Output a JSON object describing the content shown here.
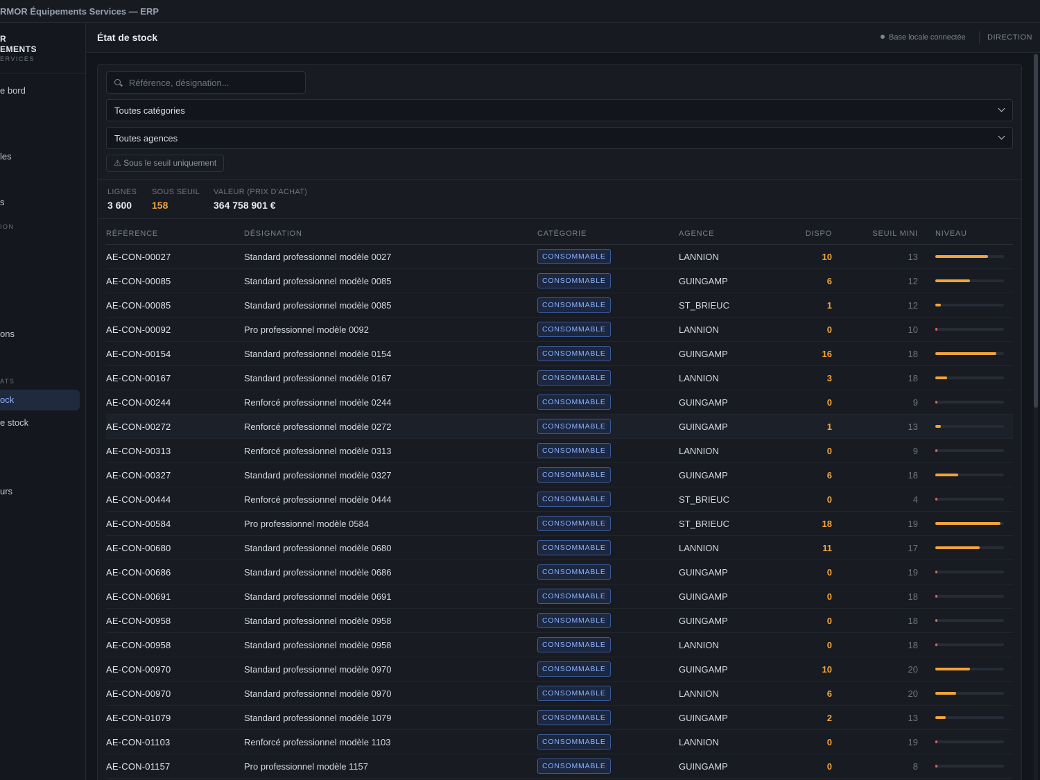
{
  "window_title": "RMOR Équipements Services — ERP",
  "brand": {
    "line1": "R",
    "line2": "EMENTS",
    "line3": "ERVICES"
  },
  "sidebar": {
    "items": [
      {
        "label": "e bord",
        "type": "item"
      },
      {
        "label": "les",
        "type": "item"
      },
      {
        "label": "s",
        "type": "item"
      },
      {
        "label": "ION",
        "type": "section"
      },
      {
        "label": "ons",
        "type": "item"
      },
      {
        "label": "ATS",
        "type": "section"
      },
      {
        "label": "ock",
        "type": "active"
      },
      {
        "label": "e stock",
        "type": "item"
      },
      {
        "label": "urs",
        "type": "item"
      }
    ]
  },
  "header": {
    "title": "État de stock",
    "status": "Base locale connectée",
    "role": "DIRECTION"
  },
  "filters": {
    "search_placeholder": "Référence, désignation...",
    "category": "Toutes catégories",
    "agency": "Toutes agences",
    "below_threshold_toggle": "⚠ Sous le seuil uniquement"
  },
  "stats": {
    "lines_label": "LIGNES",
    "lines_value": "3 600",
    "below_label": "SOUS SEUIL",
    "below_value": "158",
    "value_label": "VALEUR (PRIX D'ACHAT)",
    "value_value": "364 758 901 €"
  },
  "colors": {
    "accent": "#8fb3ff",
    "warning": "#f2a43a",
    "critical": "#e0645a",
    "background": "#12151c"
  },
  "table": {
    "columns": [
      "RÉFÉRENCE",
      "DÉSIGNATION",
      "CATÉGORIE",
      "AGENCE",
      "DISPO",
      "SEUIL MINI",
      "NIVEAU"
    ],
    "rows": [
      {
        "ref": "AE-CON-00027",
        "designation": "Standard professionnel modèle 0027",
        "category": "CONSOMMABLE",
        "agency": "LANNION",
        "dispo": "10",
        "seuil": "13",
        "level": 0.77
      },
      {
        "ref": "AE-CON-00085",
        "designation": "Standard professionnel modèle 0085",
        "category": "CONSOMMABLE",
        "agency": "GUINGAMP",
        "dispo": "6",
        "seuil": "12",
        "level": 0.5
      },
      {
        "ref": "AE-CON-00085",
        "designation": "Standard professionnel modèle 0085",
        "category": "CONSOMMABLE",
        "agency": "ST_BRIEUC",
        "dispo": "1",
        "seuil": "12",
        "level": 0.08
      },
      {
        "ref": "AE-CON-00092",
        "designation": "Pro professionnel modèle 0092",
        "category": "CONSOMMABLE",
        "agency": "LANNION",
        "dispo": "0",
        "seuil": "10",
        "level": 0
      },
      {
        "ref": "AE-CON-00154",
        "designation": "Standard professionnel modèle 0154",
        "category": "CONSOMMABLE",
        "agency": "GUINGAMP",
        "dispo": "16",
        "seuil": "18",
        "level": 0.89
      },
      {
        "ref": "AE-CON-00167",
        "designation": "Standard professionnel modèle 0167",
        "category": "CONSOMMABLE",
        "agency": "LANNION",
        "dispo": "3",
        "seuil": "18",
        "level": 0.17
      },
      {
        "ref": "AE-CON-00244",
        "designation": "Renforcé professionnel modèle 0244",
        "category": "CONSOMMABLE",
        "agency": "GUINGAMP",
        "dispo": "0",
        "seuil": "9",
        "level": 0
      },
      {
        "ref": "AE-CON-00272",
        "designation": "Renforcé professionnel modèle 0272",
        "category": "CONSOMMABLE",
        "agency": "GUINGAMP",
        "dispo": "1",
        "seuil": "13",
        "level": 0.08
      },
      {
        "ref": "AE-CON-00313",
        "designation": "Renforcé professionnel modèle 0313",
        "category": "CONSOMMABLE",
        "agency": "LANNION",
        "dispo": "0",
        "seuil": "9",
        "level": 0
      },
      {
        "ref": "AE-CON-00327",
        "designation": "Standard professionnel modèle 0327",
        "category": "CONSOMMABLE",
        "agency": "GUINGAMP",
        "dispo": "6",
        "seuil": "18",
        "level": 0.33
      },
      {
        "ref": "AE-CON-00444",
        "designation": "Renforcé professionnel modèle 0444",
        "category": "CONSOMMABLE",
        "agency": "ST_BRIEUC",
        "dispo": "0",
        "seuil": "4",
        "level": 0
      },
      {
        "ref": "AE-CON-00584",
        "designation": "Pro professionnel modèle 0584",
        "category": "CONSOMMABLE",
        "agency": "ST_BRIEUC",
        "dispo": "18",
        "seuil": "19",
        "level": 0.95
      },
      {
        "ref": "AE-CON-00680",
        "designation": "Standard professionnel modèle 0680",
        "category": "CONSOMMABLE",
        "agency": "LANNION",
        "dispo": "11",
        "seuil": "17",
        "level": 0.65
      },
      {
        "ref": "AE-CON-00686",
        "designation": "Standard professionnel modèle 0686",
        "category": "CONSOMMABLE",
        "agency": "GUINGAMP",
        "dispo": "0",
        "seuil": "19",
        "level": 0
      },
      {
        "ref": "AE-CON-00691",
        "designation": "Standard professionnel modèle 0691",
        "category": "CONSOMMABLE",
        "agency": "GUINGAMP",
        "dispo": "0",
        "seuil": "18",
        "level": 0
      },
      {
        "ref": "AE-CON-00958",
        "designation": "Standard professionnel modèle 0958",
        "category": "CONSOMMABLE",
        "agency": "GUINGAMP",
        "dispo": "0",
        "seuil": "18",
        "level": 0
      },
      {
        "ref": "AE-CON-00958",
        "designation": "Standard professionnel modèle 0958",
        "category": "CONSOMMABLE",
        "agency": "LANNION",
        "dispo": "0",
        "seuil": "18",
        "level": 0
      },
      {
        "ref": "AE-CON-00970",
        "designation": "Standard professionnel modèle 0970",
        "category": "CONSOMMABLE",
        "agency": "GUINGAMP",
        "dispo": "10",
        "seuil": "20",
        "level": 0.5
      },
      {
        "ref": "AE-CON-00970",
        "designation": "Standard professionnel modèle 0970",
        "category": "CONSOMMABLE",
        "agency": "LANNION",
        "dispo": "6",
        "seuil": "20",
        "level": 0.3
      },
      {
        "ref": "AE-CON-01079",
        "designation": "Standard professionnel modèle 1079",
        "category": "CONSOMMABLE",
        "agency": "GUINGAMP",
        "dispo": "2",
        "seuil": "13",
        "level": 0.15
      },
      {
        "ref": "AE-CON-01103",
        "designation": "Renforcé professionnel modèle 1103",
        "category": "CONSOMMABLE",
        "agency": "LANNION",
        "dispo": "0",
        "seuil": "19",
        "level": 0
      },
      {
        "ref": "AE-CON-01157",
        "designation": "Pro professionnel modèle 1157",
        "category": "CONSOMMABLE",
        "agency": "GUINGAMP",
        "dispo": "0",
        "seuil": "8",
        "level": 0
      }
    ]
  }
}
